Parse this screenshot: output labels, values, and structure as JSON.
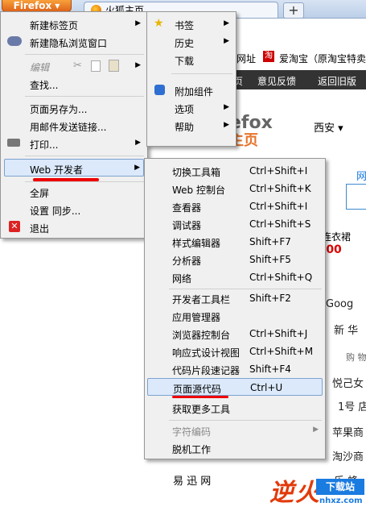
{
  "browser": {
    "app_button": "Firefox",
    "tab_title": "火狐主页",
    "new_tab_symbol": "+"
  },
  "page_bg": {
    "bookmark_a": "网址",
    "bookmark_b": "爱淘宝（原淘宝特卖",
    "nav_items": [
      "页",
      "意见反馈",
      "返回旧版"
    ],
    "logo_text": "efox",
    "logo_sub": "主页",
    "city": "西安",
    "search_tab": "网",
    "promo": "连衣裙",
    "price": ".00",
    "right_links": [
      "Goog",
      "新 华",
      "购 物",
      "悦己女",
      "1号 店",
      "苹果商",
      "淘沙商",
      "乐 蜂"
    ],
    "bottom_link": "易 迅 网"
  },
  "main_menu": {
    "items": [
      {
        "label": "新建标签页",
        "sub": true
      },
      {
        "label": "新建隐私浏览窗口",
        "sub": false
      },
      {
        "label": "编辑",
        "sub": true
      },
      {
        "label": "查找...",
        "sub": false
      },
      {
        "label": "页面另存为...",
        "sub": false
      },
      {
        "label": "用邮件发送链接...",
        "sub": false
      },
      {
        "label": "打印...",
        "sub": true
      },
      {
        "label": "Web 开发者",
        "sub": true
      },
      {
        "label": "全屏",
        "sub": false
      },
      {
        "label": "设置 同步...",
        "sub": false
      },
      {
        "label": "退出",
        "sub": false
      }
    ]
  },
  "right_menu": {
    "items": [
      {
        "label": "书签",
        "sub": true
      },
      {
        "label": "历史",
        "sub": true
      },
      {
        "label": "下载",
        "sub": false
      },
      {
        "label": "附加组件",
        "sub": false
      },
      {
        "label": "选项",
        "sub": true
      },
      {
        "label": "帮助",
        "sub": true
      }
    ]
  },
  "dev_menu": {
    "items": [
      {
        "label": "切换工具箱",
        "shortcut": "Ctrl+Shift+I"
      },
      {
        "label": "Web 控制台",
        "shortcut": "Ctrl+Shift+K"
      },
      {
        "label": "查看器",
        "shortcut": "Ctrl+Shift+I"
      },
      {
        "label": "调试器",
        "shortcut": "Ctrl+Shift+S"
      },
      {
        "label": "样式编辑器",
        "shortcut": "Shift+F7"
      },
      {
        "label": "分析器",
        "shortcut": "Shift+F5"
      },
      {
        "label": "网络",
        "shortcut": "Ctrl+Shift+Q"
      },
      {
        "label": "开发者工具栏",
        "shortcut": "Shift+F2"
      },
      {
        "label": "应用管理器",
        "shortcut": ""
      },
      {
        "label": "浏览器控制台",
        "shortcut": "Ctrl+Shift+J"
      },
      {
        "label": "响应式设计视图",
        "shortcut": "Ctrl+Shift+M"
      },
      {
        "label": "代码片段速记器",
        "shortcut": "Shift+F4"
      },
      {
        "label": "页面源代码",
        "shortcut": "Ctrl+U"
      },
      {
        "label": "获取更多工具",
        "shortcut": ""
      },
      {
        "label": "字符编码",
        "shortcut": ""
      },
      {
        "label": "脱机工作",
        "shortcut": ""
      }
    ]
  },
  "watermark": {
    "big": "逆火",
    "box": "下载站",
    "url": "nhxz.com"
  },
  "colors": {
    "highlight": "#dbe9fb",
    "underline": "#e00000",
    "firefox_orange": "#e0641a"
  }
}
